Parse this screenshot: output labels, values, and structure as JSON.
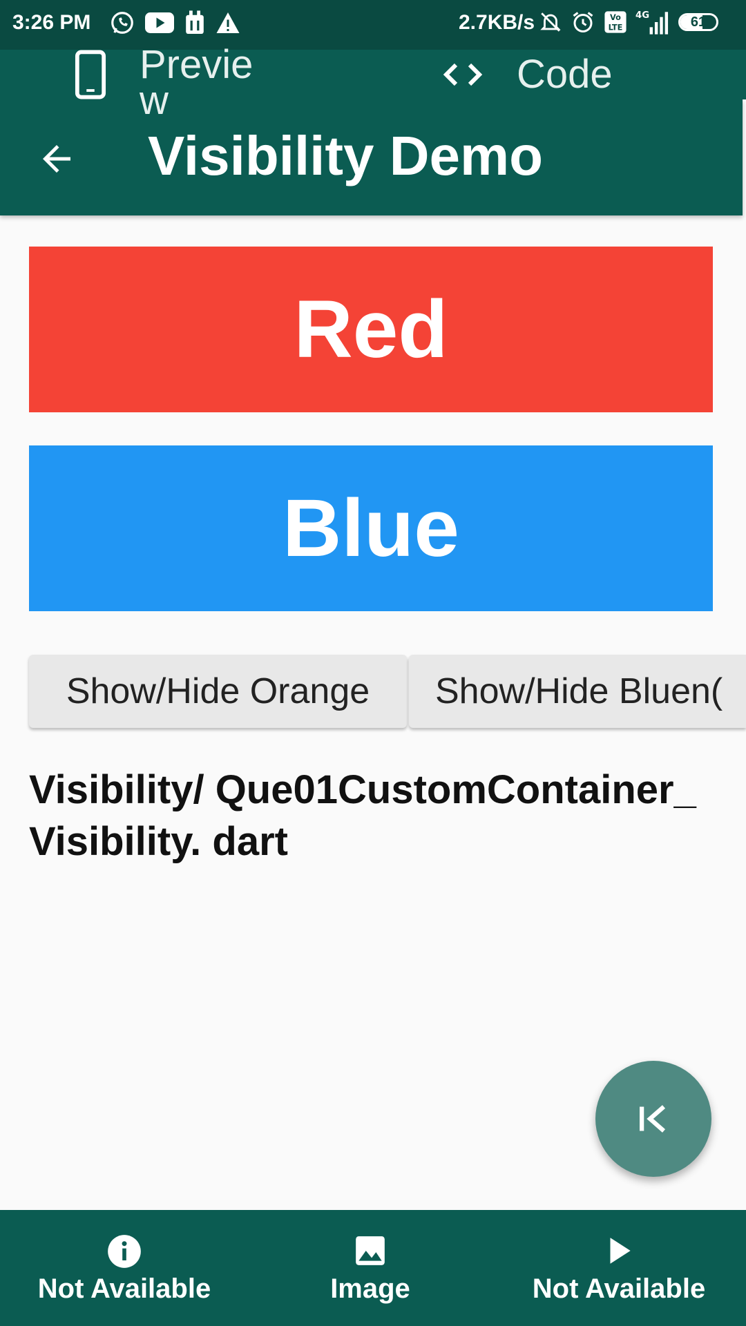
{
  "status_bar": {
    "time": "3:26 PM",
    "network_speed": "2.7KB/s",
    "network_type": "4G",
    "volte_label": "Vo LTE",
    "battery_level": "61",
    "battery_fraction": 0.61,
    "left_icons": [
      "whatsapp-icon",
      "youtube-icon",
      "calendar-icon",
      "warning-icon"
    ],
    "right_icons": [
      "mute-bell-icon",
      "alarm-icon",
      "volte-icon",
      "signal-icon",
      "battery-icon"
    ]
  },
  "top_tabs": [
    {
      "label": "Preview",
      "icon": "phone-icon"
    },
    {
      "label": "Code",
      "icon": "code-icon"
    }
  ],
  "app_bar": {
    "title": "Visibility Demo",
    "back_icon": "arrow-back-icon"
  },
  "boxes": {
    "red": {
      "label": "Red",
      "color": "#f44336"
    },
    "blue": {
      "label": "Blue",
      "color": "#2196f3"
    }
  },
  "buttons": {
    "orange": "Show/Hide Orange",
    "blue": "Show/Hide Bluen("
  },
  "file_path": "Visibility/ Que01CustomContainer_Visibility. dart",
  "fab": {
    "icon": "skip-to-start-icon"
  },
  "bottom_nav": [
    {
      "label": "Not Available",
      "icon": "info-icon"
    },
    {
      "label": "Image",
      "icon": "image-icon"
    },
    {
      "label": "Not Available",
      "icon": "play-icon"
    }
  ],
  "colors": {
    "primary": "#0b5c52",
    "status_bar": "#0a4a41",
    "fab": "#4f8a82"
  }
}
